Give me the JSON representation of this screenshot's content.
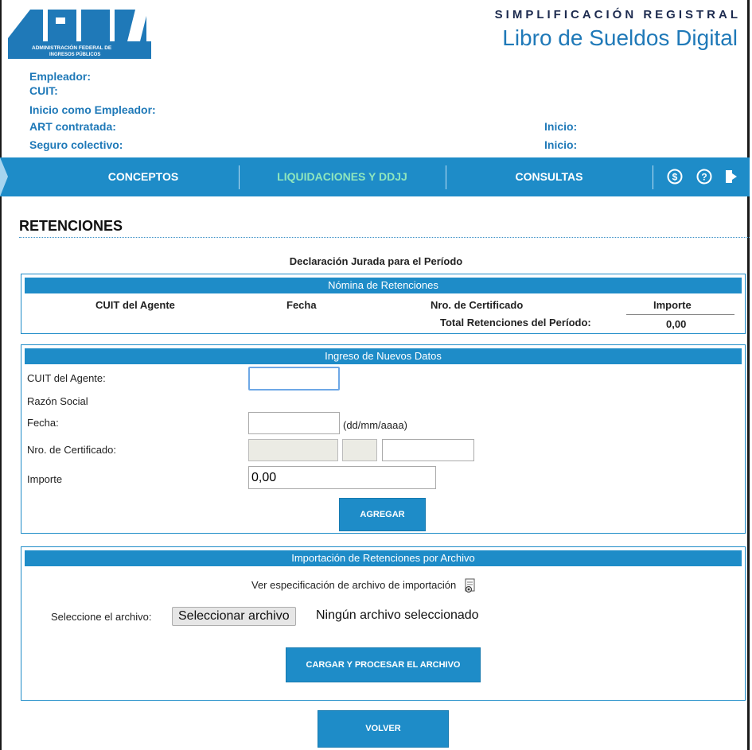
{
  "header": {
    "logo_text": [
      "ADMINISTRACIÓN FEDERAL DE",
      "INGRESOS PÚBLICOS"
    ],
    "brand_top": "SIMPLIFICACIÓN REGISTRAL",
    "brand_main": "Libro de Sueldos Digital"
  },
  "employer_info": {
    "empleador": "Empleador:",
    "cuit": "CUIT:",
    "inicio_empleador": "Inicio como Empleador:",
    "art": "ART contratada:",
    "seguro": "Seguro colectivo:",
    "inicio_art": "Inicio:",
    "inicio_seguro": "Inicio:"
  },
  "nav": {
    "items": [
      "CONCEPTOS",
      "LIQUIDACIONES Y DDJJ",
      "CONSULTAS"
    ],
    "active": "LIQUIDACIONES Y DDJJ",
    "icons": [
      "dollar-icon",
      "help-icon",
      "logout-icon"
    ]
  },
  "page": {
    "title": "RETENCIONES",
    "ddjj_label": "Declaración Jurada para el Período"
  },
  "nomina": {
    "header": "Nómina de Retenciones",
    "columns": [
      "CUIT del Agente",
      "Fecha",
      "Nro. de Certificado",
      "Importe"
    ],
    "total_label": "Total Retenciones del Período:",
    "total_value": "0,00"
  },
  "ingreso": {
    "header": "Ingreso de Nuevos Datos",
    "cuit_label": "CUIT del Agente:",
    "razon_label": "Razón Social",
    "fecha_label": "Fecha:",
    "fecha_hint": "(dd/mm/aaaa)",
    "cert_label": "Nro. de Certificado:",
    "importe_label": "Importe",
    "importe_value": "0,00",
    "add_button": "AGREGAR"
  },
  "importacion": {
    "header": "Importación de Retenciones por Archivo",
    "spec_link": "Ver especificación de archivo de importación",
    "select_label": "Seleccione el archivo:",
    "file_button": "Seleccionar archivo",
    "file_status": "Ningún archivo seleccionado",
    "process_button": "CARGAR Y PROCESAR EL ARCHIVO"
  },
  "footer": {
    "back_button": "VOLVER"
  },
  "colors": {
    "accent": "#1e8cc8",
    "nav_active": "#8fe6bd",
    "label_blue": "#1f79b8"
  }
}
